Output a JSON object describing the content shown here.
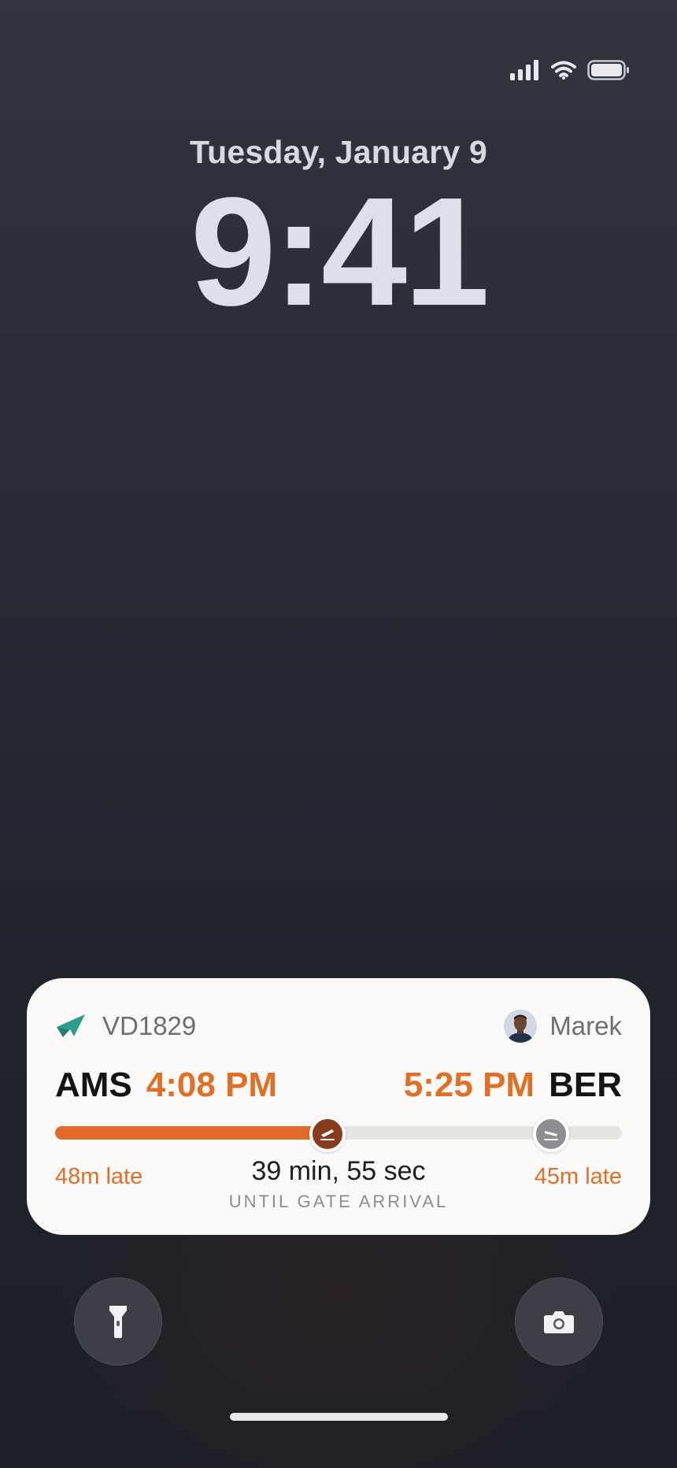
{
  "status_bar": {
    "signal_icon": "cellular-signal-icon",
    "wifi_icon": "wifi-icon",
    "battery_icon": "battery-icon"
  },
  "lock_screen": {
    "date": "Tuesday, January 9",
    "time": "9:41"
  },
  "live_activity": {
    "airline_icon": "paper-plane-icon",
    "flight_number": "VD1829",
    "passenger_avatar_icon": "avatar",
    "passenger_name": "Marek",
    "origin": {
      "airport": "AMS",
      "time": "4:08 PM",
      "delay": "48m late"
    },
    "destination": {
      "airport": "BER",
      "time": "5:25 PM",
      "delay": "45m late"
    },
    "progress_fraction": 0.48,
    "arrival_marker_fraction": 0.875,
    "countdown": "39 min, 55 sec",
    "countdown_label": "UNTIL GATE ARRIVAL",
    "colors": {
      "accent": "#e06a2c",
      "departure_marker": "#8a3a1c",
      "arrival_marker": "#8d8e92",
      "airline_icon": "#2a9d8f"
    }
  },
  "quick_actions": {
    "left_icon": "flashlight-icon",
    "right_icon": "camera-icon"
  }
}
